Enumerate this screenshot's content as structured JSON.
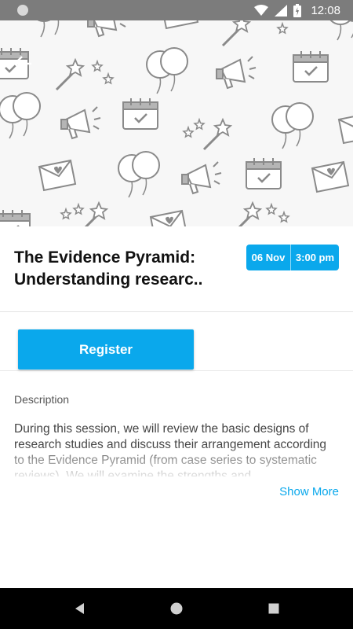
{
  "status_bar": {
    "time": "12:08",
    "icons": [
      "wifi-icon",
      "signal-icon",
      "battery-icon"
    ]
  },
  "hero": {
    "pattern": "event-doodle-pattern",
    "back_icon": "arrow-back-icon"
  },
  "event": {
    "title": "The Evidence Pyramid: Understanding researc..",
    "date": "06 Nov",
    "time": "3:00 pm"
  },
  "register": {
    "label": "Register"
  },
  "description": {
    "label": "Description",
    "text": "During this session, we will review the basic designs of research studies and discuss their arrangement according to the Evidence Pyramid (from case series to systematic reviews). We will examine the strengths and",
    "show_more": "Show More"
  },
  "nav_bar": {
    "buttons": [
      "back-triangle-icon",
      "home-circle-icon",
      "recents-square-icon"
    ]
  },
  "colors": {
    "accent": "#0aa8ec",
    "status_bar": "#7c7c7c",
    "nav_bar": "#000000"
  }
}
